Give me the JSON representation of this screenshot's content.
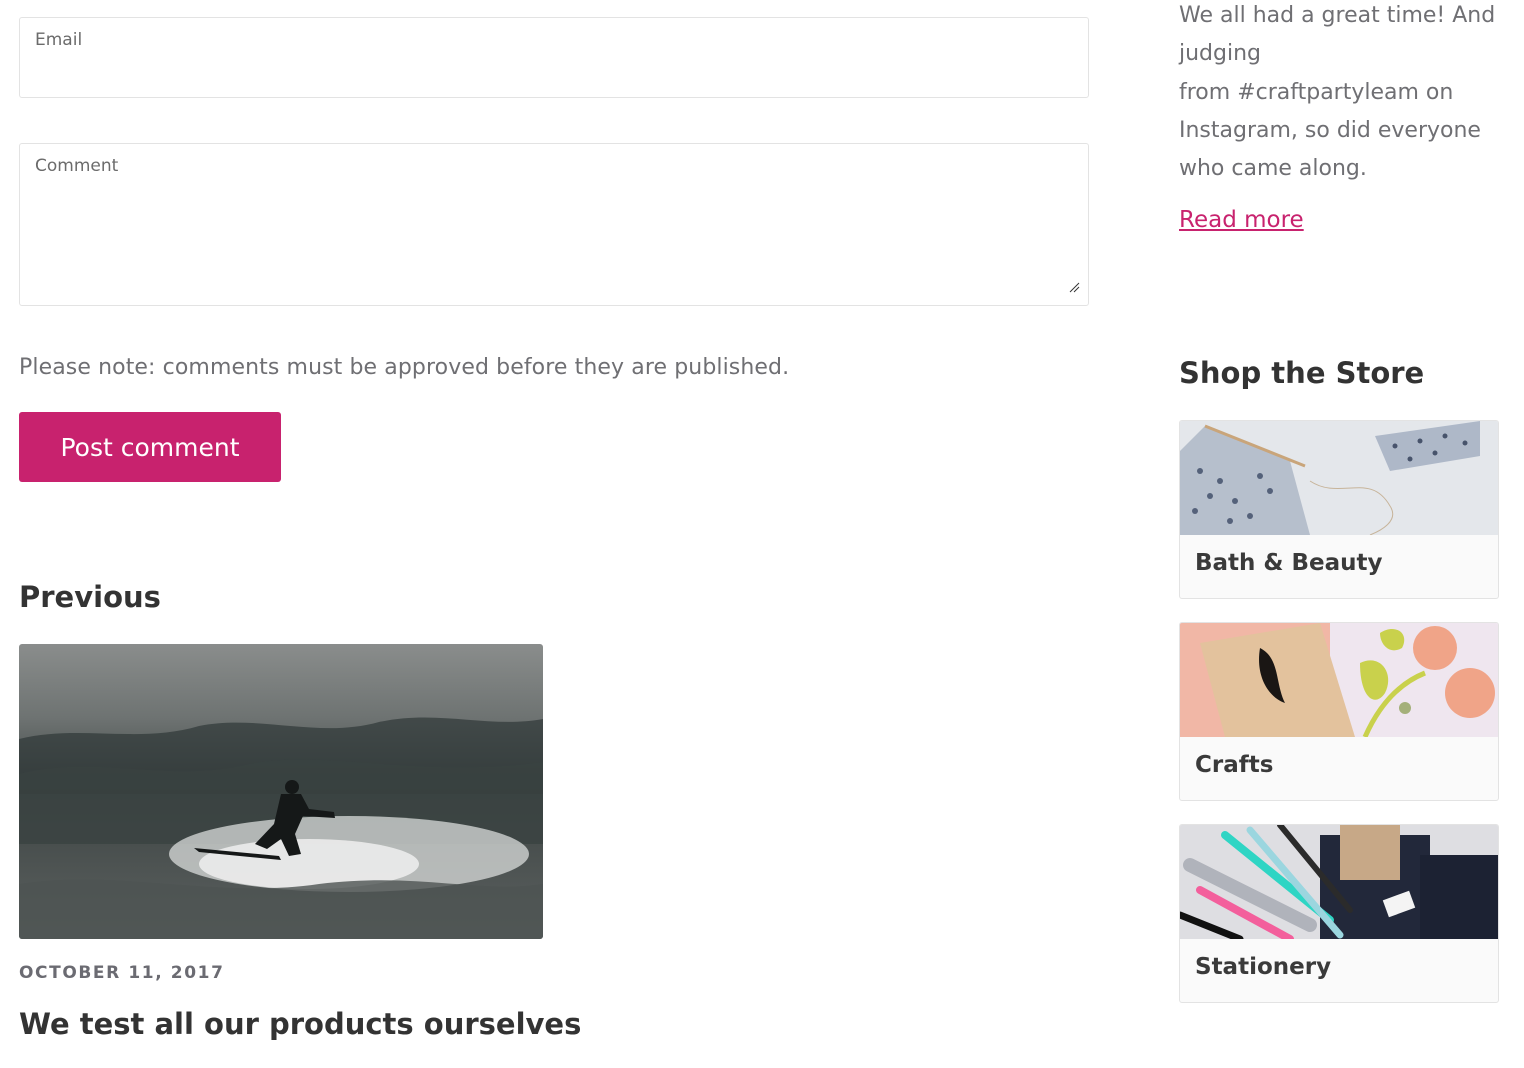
{
  "comment_form": {
    "email_label": "Email",
    "comment_label": "Comment",
    "email_value": "",
    "comment_value": "",
    "note": "Please note: comments must be approved before they are published.",
    "submit_label": "Post comment"
  },
  "previous": {
    "heading": "Previous",
    "image_alt": "surfer-riding-wave-photo",
    "date": "OCTOBER 11, 2017",
    "title": "We test all our products ourselves"
  },
  "sidebar": {
    "excerpt_lines": [
      "We all had a great time! And",
      "judging",
      "from #craftpartyleam on",
      "Instagram, so did everyone",
      "who came along."
    ],
    "read_more": "Read more",
    "shop_heading": "Shop the Store",
    "collections": [
      {
        "label": "Bath & Beauty"
      },
      {
        "label": "Crafts"
      },
      {
        "label": "Stationery"
      }
    ]
  },
  "colors": {
    "accent": "#c8226e",
    "muted_text": "#6f6f73",
    "heading_text": "#333333",
    "border": "#e3e3e3"
  }
}
